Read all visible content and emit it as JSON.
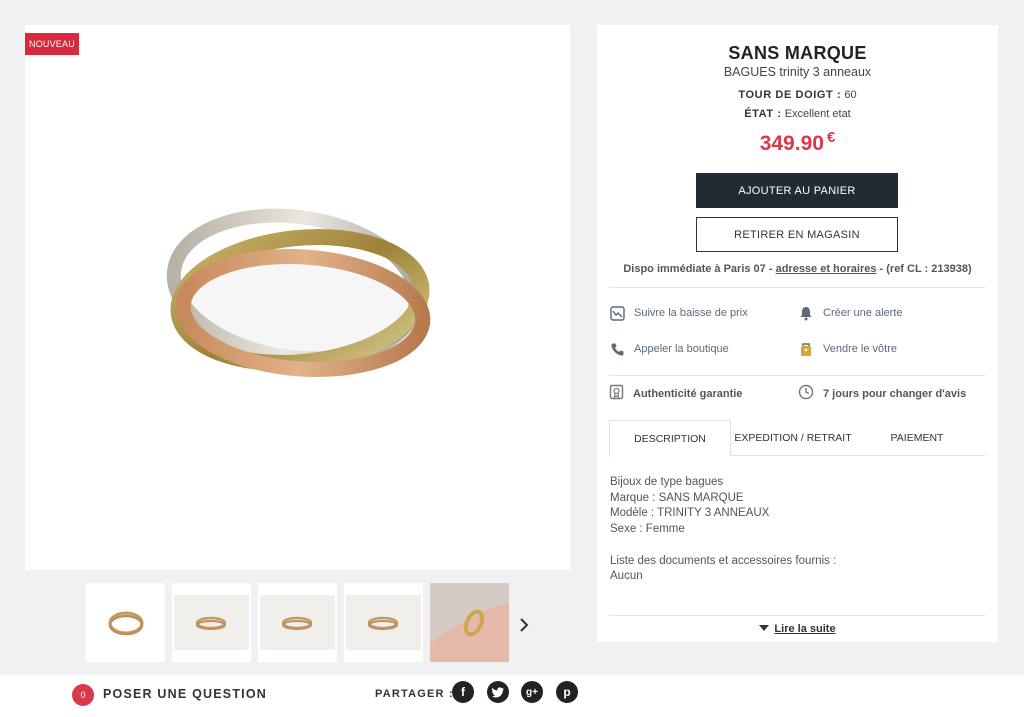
{
  "badge": "NOUVEAU",
  "product": {
    "brand": "SANS MARQUE",
    "model": "BAGUES trinity 3 anneaux",
    "size_label": "TOUR DE DOIGT :",
    "size_value": "60",
    "state_label": "ÉTAT :",
    "state_value": "Excellent etat",
    "price": "349.90",
    "currency": "€"
  },
  "buttons": {
    "add_to_cart": "AJOUTER AU PANIER",
    "pickup_store": "RETIRER EN MAGASIN"
  },
  "availability": {
    "prefix": "Dispo immédiate à Paris 07 - ",
    "link": "adresse et horaires",
    "suffix": " - (ref CL : 213938)"
  },
  "actions": {
    "price_watch": "Suivre la baisse de prix",
    "create_alert": "Créer une alerte",
    "call_shop": "Appeler la boutique",
    "sell_yours": "Vendre le vôtre"
  },
  "guarantees": {
    "authenticity": "Authenticité garantie",
    "return_days": "7 jours pour changer d'avis"
  },
  "tabs": {
    "description": "DESCRIPTION",
    "shipping": "EXPEDITION / RETRAIT",
    "payment": "PAIEMENT"
  },
  "description": {
    "line1": "Bijoux de type bagues",
    "line2": "Marque : SANS MARQUE",
    "line3": "Modèle : TRINITY 3 ANNEAUX",
    "line4": "Sexe : Femme",
    "line5": "Liste des documents et accessoires fournis :",
    "line6": "Aucun"
  },
  "read_more": "Lire la suite",
  "bottom": {
    "question_count": "0",
    "question_label": "POSER UNE QUESTION",
    "share_label": "PARTAGER :"
  },
  "social": {
    "facebook": "f",
    "googleplus": "g+",
    "pinterest": "p"
  },
  "colors": {
    "accent_red": "#d9394a",
    "cart_button": "#222a33",
    "action_text": "#5b6a7c"
  }
}
